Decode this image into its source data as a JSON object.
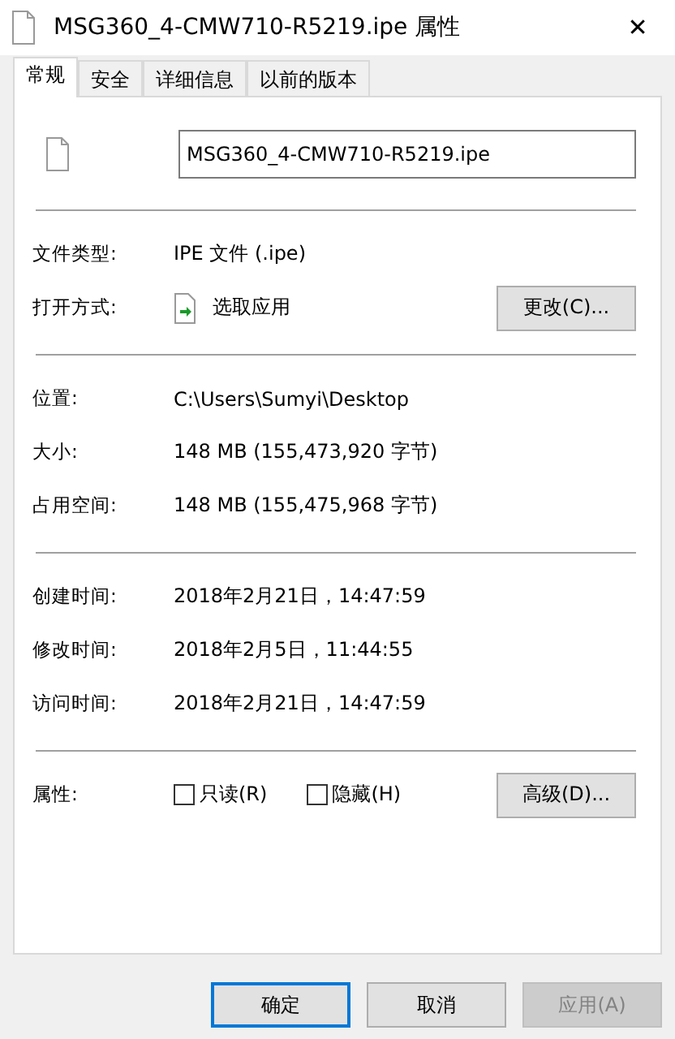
{
  "window": {
    "title": "MSG360_4-CMW710-R5219.ipe 属性",
    "close": "✕"
  },
  "tabs": [
    {
      "label": "常规",
      "selected": true
    },
    {
      "label": "安全",
      "selected": false
    },
    {
      "label": "详细信息",
      "selected": false
    },
    {
      "label": "以前的版本",
      "selected": false
    }
  ],
  "file_name": {
    "value": "MSG360_4-CMW710-R5219.ipe"
  },
  "sections": [
    [
      {
        "kind": "text",
        "label": "文件类型:",
        "value": "IPE 文件 (.ipe)"
      },
      {
        "kind": "app",
        "label": "打开方式:",
        "value": "选取应用",
        "button": "更改(C)..."
      }
    ],
    [
      {
        "kind": "text",
        "label": "位置:",
        "value": "C:\\Users\\Sumyi\\Desktop"
      },
      {
        "kind": "text",
        "label": "大小:",
        "value": "148 MB (155,473,920 字节)"
      },
      {
        "kind": "text",
        "label": "占用空间:",
        "value": "148 MB (155,475,968 字节)"
      }
    ],
    [
      {
        "kind": "text",
        "label": "创建时间:",
        "value": "2018年2月21日，14:47:59"
      },
      {
        "kind": "text",
        "label": "修改时间:",
        "value": "2018年2月5日，11:44:55"
      },
      {
        "kind": "text",
        "label": "访问时间:",
        "value": "2018年2月21日，14:47:59"
      }
    ],
    [
      {
        "kind": "attributes",
        "label": "属性:",
        "checkboxes": [
          {
            "label": "只读(R)",
            "checked": false
          },
          {
            "label": "隐藏(H)",
            "checked": false
          }
        ],
        "button": "高级(D)..."
      }
    ]
  ],
  "buttons": [
    {
      "label": "确定",
      "default": true,
      "disabled": false
    },
    {
      "label": "取消",
      "default": false,
      "disabled": false
    },
    {
      "label": "应用(A)",
      "default": false,
      "disabled": true
    }
  ]
}
